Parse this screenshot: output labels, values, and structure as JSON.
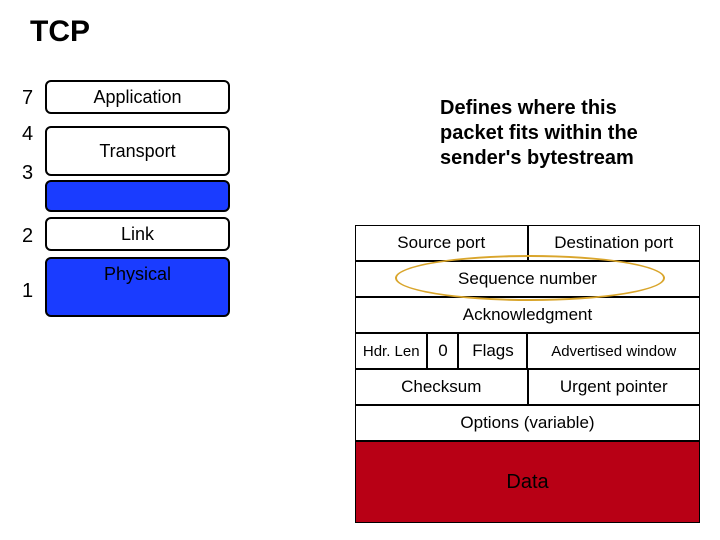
{
  "title": "TCP",
  "layers": {
    "n7": "7",
    "n4": "4",
    "n3": "3",
    "n2": "2",
    "n1": "1",
    "application": "Application",
    "transport": "Transport",
    "link": "Link",
    "physical": "Physical"
  },
  "caption": {
    "l1": "Defines where this",
    "l2": "packet fits within the",
    "l3": "sender's bytestream"
  },
  "tcp": {
    "src_port": "Source port",
    "dst_port": "Destination port",
    "seq": "Sequence number",
    "ack": "Acknowledgment",
    "hdrlen": "Hdr. Len",
    "zero": "0",
    "flags": "Flags",
    "adv_window": "Advertised window",
    "checksum": "Checksum",
    "urgent": "Urgent pointer",
    "options": "Options (variable)",
    "data": "Data"
  }
}
